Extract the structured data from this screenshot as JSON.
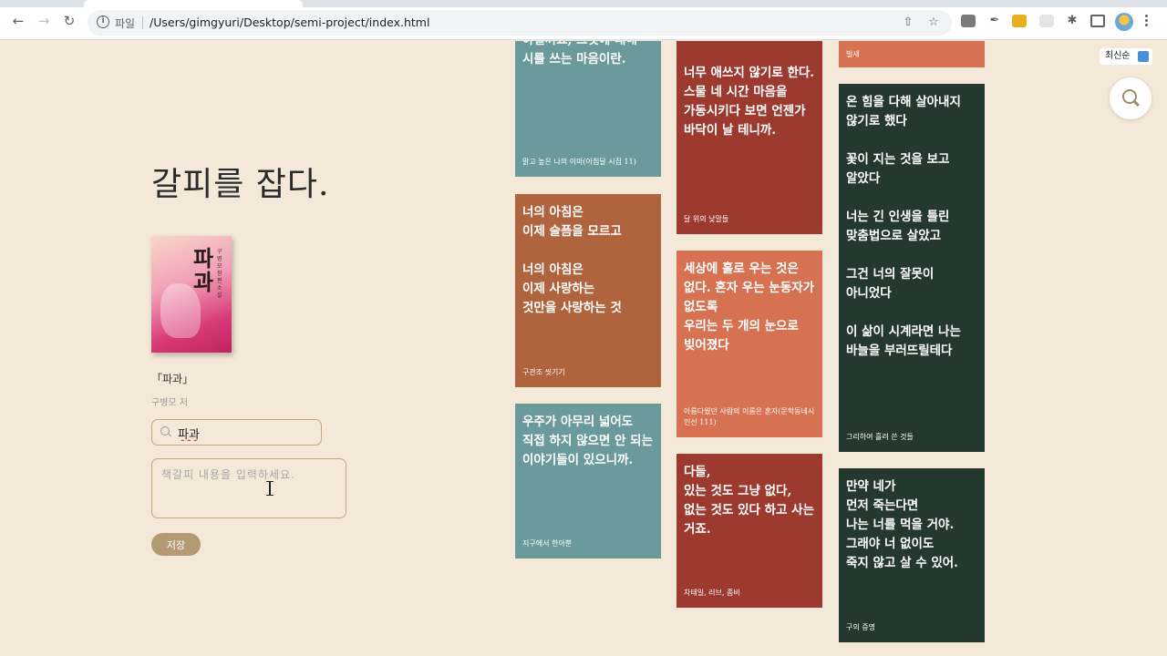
{
  "browser": {
    "scheme_label": "파일",
    "url": "/Users/gimgyuri/Desktop/semi-project/index.html"
  },
  "page": {
    "title": "갈피를 잡다.",
    "book": {
      "cover_title": "파과",
      "cover_author": "구병모 장편소설",
      "name": "「파과」",
      "author": "구병모 저"
    },
    "search": {
      "value": "파과"
    },
    "memo": {
      "placeholder": "책갈피 내용을 입력하세요."
    },
    "save_label": "저장",
    "sort_label": "최신순"
  },
  "colors": {
    "teal": "#6b9a9c",
    "brown": "#b0643d",
    "red": "#9d3a2f",
    "orange": "#d67252",
    "dark_green": "#243830",
    "background": "#f4e8d8"
  },
  "cards": [
    {
      "text": "아닐까요, 그것에 대해 시를 쓰는 마음이란.",
      "source": "맑고 높은 나의 이마(아침달 시집 11)",
      "color": "#6b9a9c"
    },
    {
      "text": "너의 아침은\n이제 슬픔을 모르고\n\n너의 아침은\n이제 사랑하는\n것만을 사랑하는 것",
      "source": "구관조 씻기기",
      "color": "#b0643d"
    },
    {
      "text": "우주가 아무리 넓어도 직접 하지 않으면 안 되는 이야기들이 있으니까.",
      "source": "지구에서 한아뿐",
      "color": "#6b9a9c"
    },
    {
      "text": "안 고생이 될 테니까.\n\n너무 애쓰지 않기로 한다. 스물 네 시간 마음을 가동시키다 보면 언젠가 바닥이 날 테니까.",
      "source": "달 위의 낮말들",
      "color": "#9d3a2f"
    },
    {
      "text": "세상에 홀로 우는 것은 없다. 혼자 우는 눈동자가 없도록\n우리는 두 개의 눈으로 빚어졌다",
      "source": "아름다웠던 사람의 이름은 혼자(문학동네시인선 111)",
      "color": "#d67252"
    },
    {
      "text": "다들,\n있는 것도 그냥 없다, 없는 것도 있다 하고 사는 거죠.",
      "source": "차태일, 러브, 좀비",
      "color": "#9d3a2f"
    },
    {
      "text": "",
      "source": "빌새",
      "color": "#d67252"
    },
    {
      "text": "온 힘을 다해 살아내지 않기로 했다\n\n꽃이 지는 것을 보고 알았다\n\n너는 긴 인생을 틀린 맞춤법으로 살았고\n\n그건 너의 잘못이 아니었다\n\n이 삶이 시계라면 나는 바늘을 부러뜨릴테다",
      "source": "그리하여 흘려 쓴 것들",
      "color": "#243830"
    },
    {
      "text": "만약 네가\n먼저 죽는다면\n나는 너를 먹을 거야.\n그래야 너 없이도\n죽지 않고 살 수 있어.",
      "source": "구의 증명",
      "color": "#243830"
    }
  ]
}
